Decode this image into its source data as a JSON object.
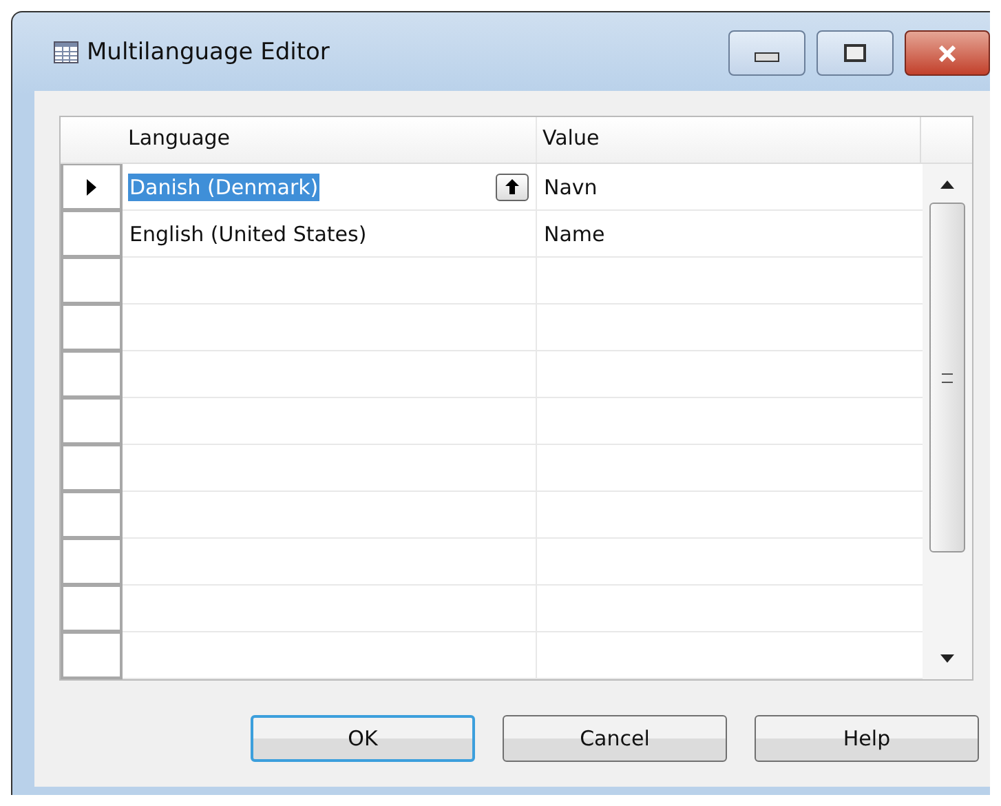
{
  "window": {
    "title": "Multilanguage Editor"
  },
  "table": {
    "columns": [
      "Language",
      "Value"
    ],
    "rows": [
      {
        "language": "Danish (Denmark)",
        "value": "Navn",
        "selected": true
      },
      {
        "language": "English (United States)",
        "value": "Name",
        "selected": false
      }
    ]
  },
  "buttons": [
    {
      "label": "OK",
      "default": true
    },
    {
      "label": "Cancel",
      "default": false
    },
    {
      "label": "Help",
      "default": false
    }
  ]
}
